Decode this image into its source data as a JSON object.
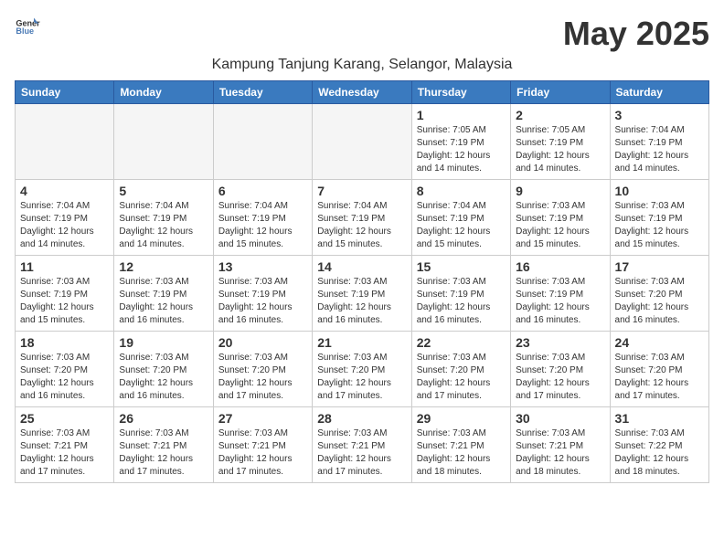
{
  "header": {
    "logo_line1": "General",
    "logo_line2": "Blue",
    "month_title": "May 2025",
    "location": "Kampung Tanjung Karang, Selangor, Malaysia"
  },
  "weekdays": [
    "Sunday",
    "Monday",
    "Tuesday",
    "Wednesday",
    "Thursday",
    "Friday",
    "Saturday"
  ],
  "weeks": [
    [
      {
        "day": "",
        "empty": true
      },
      {
        "day": "",
        "empty": true
      },
      {
        "day": "",
        "empty": true
      },
      {
        "day": "",
        "empty": true
      },
      {
        "day": "1",
        "sunrise": "7:05 AM",
        "sunset": "7:19 PM",
        "daylight": "12 hours and 14 minutes."
      },
      {
        "day": "2",
        "sunrise": "7:05 AM",
        "sunset": "7:19 PM",
        "daylight": "12 hours and 14 minutes."
      },
      {
        "day": "3",
        "sunrise": "7:04 AM",
        "sunset": "7:19 PM",
        "daylight": "12 hours and 14 minutes."
      }
    ],
    [
      {
        "day": "4",
        "sunrise": "7:04 AM",
        "sunset": "7:19 PM",
        "daylight": "12 hours and 14 minutes."
      },
      {
        "day": "5",
        "sunrise": "7:04 AM",
        "sunset": "7:19 PM",
        "daylight": "12 hours and 14 minutes."
      },
      {
        "day": "6",
        "sunrise": "7:04 AM",
        "sunset": "7:19 PM",
        "daylight": "12 hours and 15 minutes."
      },
      {
        "day": "7",
        "sunrise": "7:04 AM",
        "sunset": "7:19 PM",
        "daylight": "12 hours and 15 minutes."
      },
      {
        "day": "8",
        "sunrise": "7:04 AM",
        "sunset": "7:19 PM",
        "daylight": "12 hours and 15 minutes."
      },
      {
        "day": "9",
        "sunrise": "7:03 AM",
        "sunset": "7:19 PM",
        "daylight": "12 hours and 15 minutes."
      },
      {
        "day": "10",
        "sunrise": "7:03 AM",
        "sunset": "7:19 PM",
        "daylight": "12 hours and 15 minutes."
      }
    ],
    [
      {
        "day": "11",
        "sunrise": "7:03 AM",
        "sunset": "7:19 PM",
        "daylight": "12 hours and 15 minutes."
      },
      {
        "day": "12",
        "sunrise": "7:03 AM",
        "sunset": "7:19 PM",
        "daylight": "12 hours and 16 minutes."
      },
      {
        "day": "13",
        "sunrise": "7:03 AM",
        "sunset": "7:19 PM",
        "daylight": "12 hours and 16 minutes."
      },
      {
        "day": "14",
        "sunrise": "7:03 AM",
        "sunset": "7:19 PM",
        "daylight": "12 hours and 16 minutes."
      },
      {
        "day": "15",
        "sunrise": "7:03 AM",
        "sunset": "7:19 PM",
        "daylight": "12 hours and 16 minutes."
      },
      {
        "day": "16",
        "sunrise": "7:03 AM",
        "sunset": "7:19 PM",
        "daylight": "12 hours and 16 minutes."
      },
      {
        "day": "17",
        "sunrise": "7:03 AM",
        "sunset": "7:20 PM",
        "daylight": "12 hours and 16 minutes."
      }
    ],
    [
      {
        "day": "18",
        "sunrise": "7:03 AM",
        "sunset": "7:20 PM",
        "daylight": "12 hours and 16 minutes."
      },
      {
        "day": "19",
        "sunrise": "7:03 AM",
        "sunset": "7:20 PM",
        "daylight": "12 hours and 16 minutes."
      },
      {
        "day": "20",
        "sunrise": "7:03 AM",
        "sunset": "7:20 PM",
        "daylight": "12 hours and 17 minutes."
      },
      {
        "day": "21",
        "sunrise": "7:03 AM",
        "sunset": "7:20 PM",
        "daylight": "12 hours and 17 minutes."
      },
      {
        "day": "22",
        "sunrise": "7:03 AM",
        "sunset": "7:20 PM",
        "daylight": "12 hours and 17 minutes."
      },
      {
        "day": "23",
        "sunrise": "7:03 AM",
        "sunset": "7:20 PM",
        "daylight": "12 hours and 17 minutes."
      },
      {
        "day": "24",
        "sunrise": "7:03 AM",
        "sunset": "7:20 PM",
        "daylight": "12 hours and 17 minutes."
      }
    ],
    [
      {
        "day": "25",
        "sunrise": "7:03 AM",
        "sunset": "7:21 PM",
        "daylight": "12 hours and 17 minutes."
      },
      {
        "day": "26",
        "sunrise": "7:03 AM",
        "sunset": "7:21 PM",
        "daylight": "12 hours and 17 minutes."
      },
      {
        "day": "27",
        "sunrise": "7:03 AM",
        "sunset": "7:21 PM",
        "daylight": "12 hours and 17 minutes."
      },
      {
        "day": "28",
        "sunrise": "7:03 AM",
        "sunset": "7:21 PM",
        "daylight": "12 hours and 17 minutes."
      },
      {
        "day": "29",
        "sunrise": "7:03 AM",
        "sunset": "7:21 PM",
        "daylight": "12 hours and 18 minutes."
      },
      {
        "day": "30",
        "sunrise": "7:03 AM",
        "sunset": "7:21 PM",
        "daylight": "12 hours and 18 minutes."
      },
      {
        "day": "31",
        "sunrise": "7:03 AM",
        "sunset": "7:22 PM",
        "daylight": "12 hours and 18 minutes."
      }
    ]
  ]
}
